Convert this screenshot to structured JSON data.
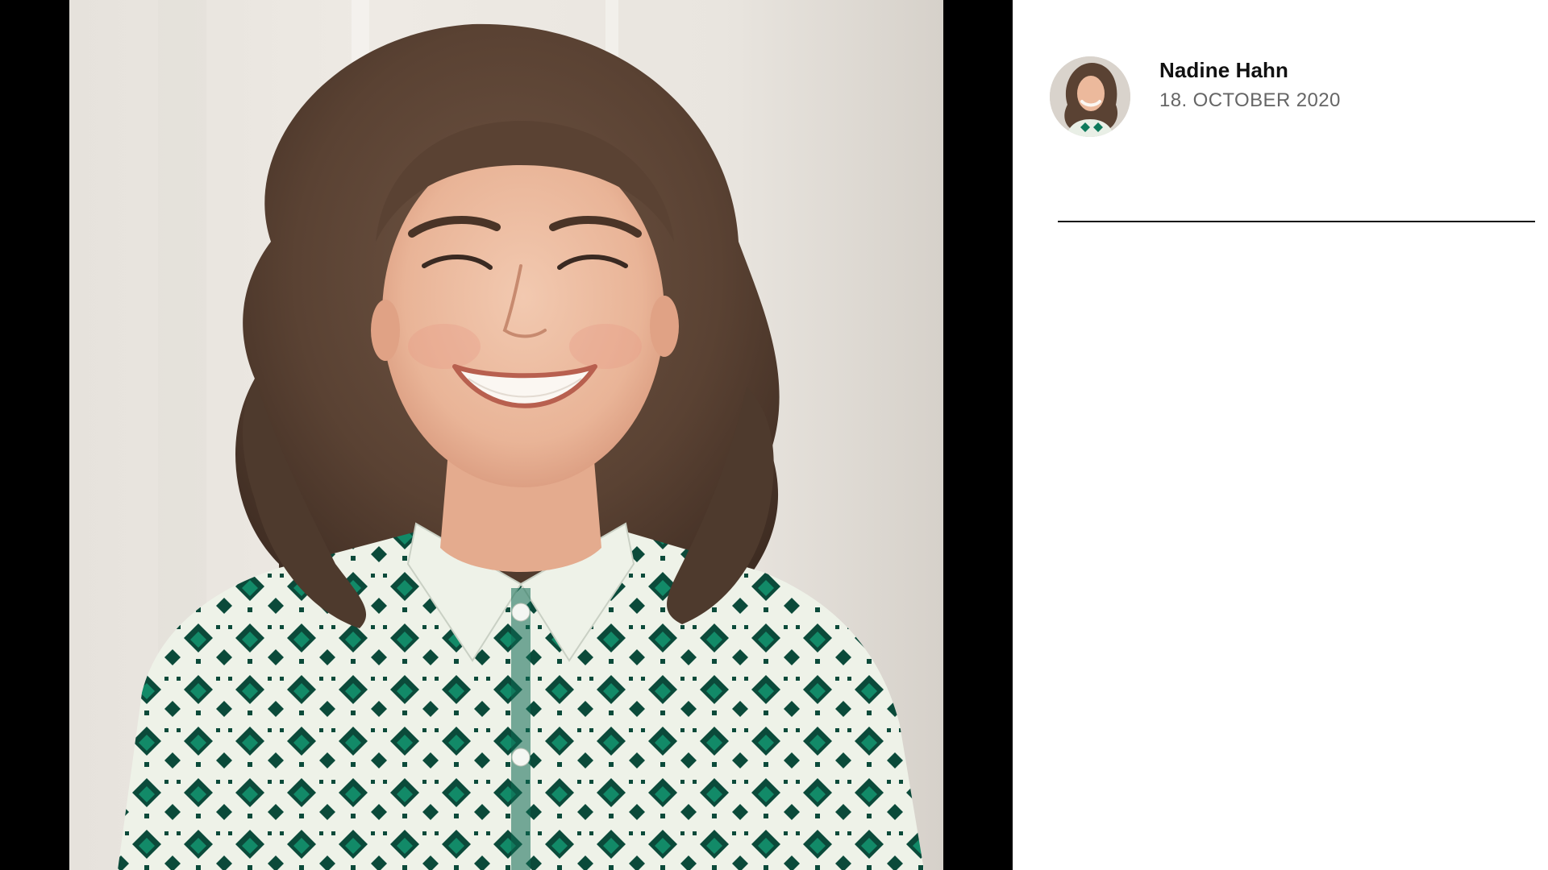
{
  "post": {
    "author_name": "Nadine Hahn",
    "date": "18. OCTOBER 2020"
  },
  "media": {
    "subject": "smiling woman with curly brown hair in green and white patterned shirt",
    "background_color": "#000000"
  },
  "icons": {
    "avatar": "avatar-photo"
  },
  "colors": {
    "page_background": "#ffffff",
    "name_text": "#111111",
    "date_text": "#666666",
    "divider": "#111111",
    "shirt_green": "#0f7a5c",
    "shirt_dark_green": "#0b4a3a"
  }
}
